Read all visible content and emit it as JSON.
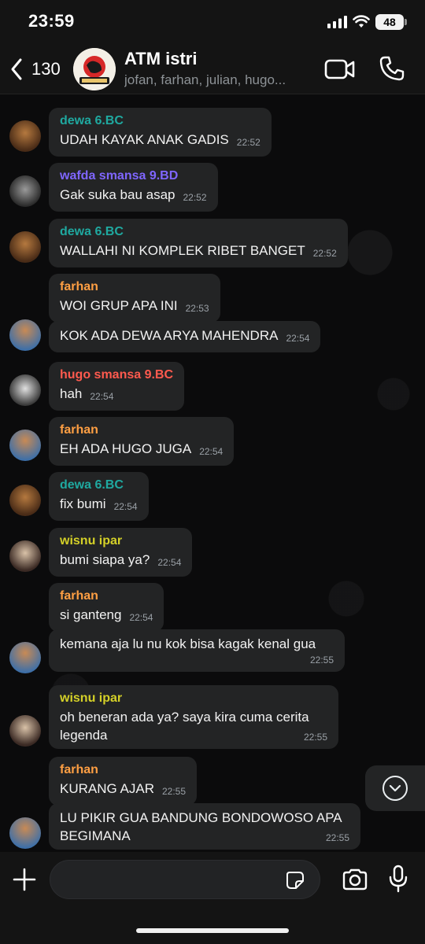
{
  "status": {
    "time": "23:59",
    "battery": "48"
  },
  "header": {
    "back_count": "130",
    "title": "ATM istri",
    "subtitle": "jofan, farhan, julian, hugo..."
  },
  "colors": {
    "dewa": "#1fa9a0",
    "wafda": "#7f66ff",
    "farhan": "#ff9f43",
    "hugo": "#ff5a4e",
    "wisnu": "#d4d028",
    "bubble": "#232425",
    "background": "#0b0b0c"
  },
  "messages": [
    {
      "sender": "dewa 6.BC",
      "text": "UDAH KAYAK ANAK GADIS",
      "time": "22:52"
    },
    {
      "sender": "wafda smansa 9.BD",
      "text": "Gak suka bau asap",
      "time": "22:52"
    },
    {
      "sender": "dewa 6.BC",
      "text": "WALLAHI NI KOMPLEK RIBET BANGET",
      "time": "22:52"
    },
    {
      "sender": "farhan",
      "text": "WOI GRUP APA INI",
      "time": "22:53"
    },
    {
      "sender": "",
      "text": "KOK ADA DEWA ARYA MAHENDRA",
      "time": "22:54"
    },
    {
      "sender": "hugo smansa 9.BC",
      "text": "hah",
      "time": "22:54"
    },
    {
      "sender": "farhan",
      "text": "EH ADA HUGO JUGA",
      "time": "22:54"
    },
    {
      "sender": "dewa 6.BC",
      "text": "fix bumi",
      "time": "22:54"
    },
    {
      "sender": "wisnu ipar",
      "text": "bumi siapa ya?",
      "time": "22:54"
    },
    {
      "sender": "farhan",
      "text": "si ganteng",
      "time": "22:54"
    },
    {
      "sender": "",
      "text": "kemana aja lu nu kok bisa kagak kenal gua",
      "time": "22:55"
    },
    {
      "sender": "wisnu ipar",
      "text": "oh beneran ada ya? saya kira cuma cerita legenda",
      "time": "22:55"
    },
    {
      "sender": "farhan",
      "text": "KURANG AJAR",
      "time": "22:55"
    },
    {
      "sender": "",
      "text": "LU PIKIR GUA BANDUNG BONDOWOSO APA BEGIMANA",
      "time": "22:55"
    }
  ],
  "composer": {
    "placeholder": ""
  }
}
